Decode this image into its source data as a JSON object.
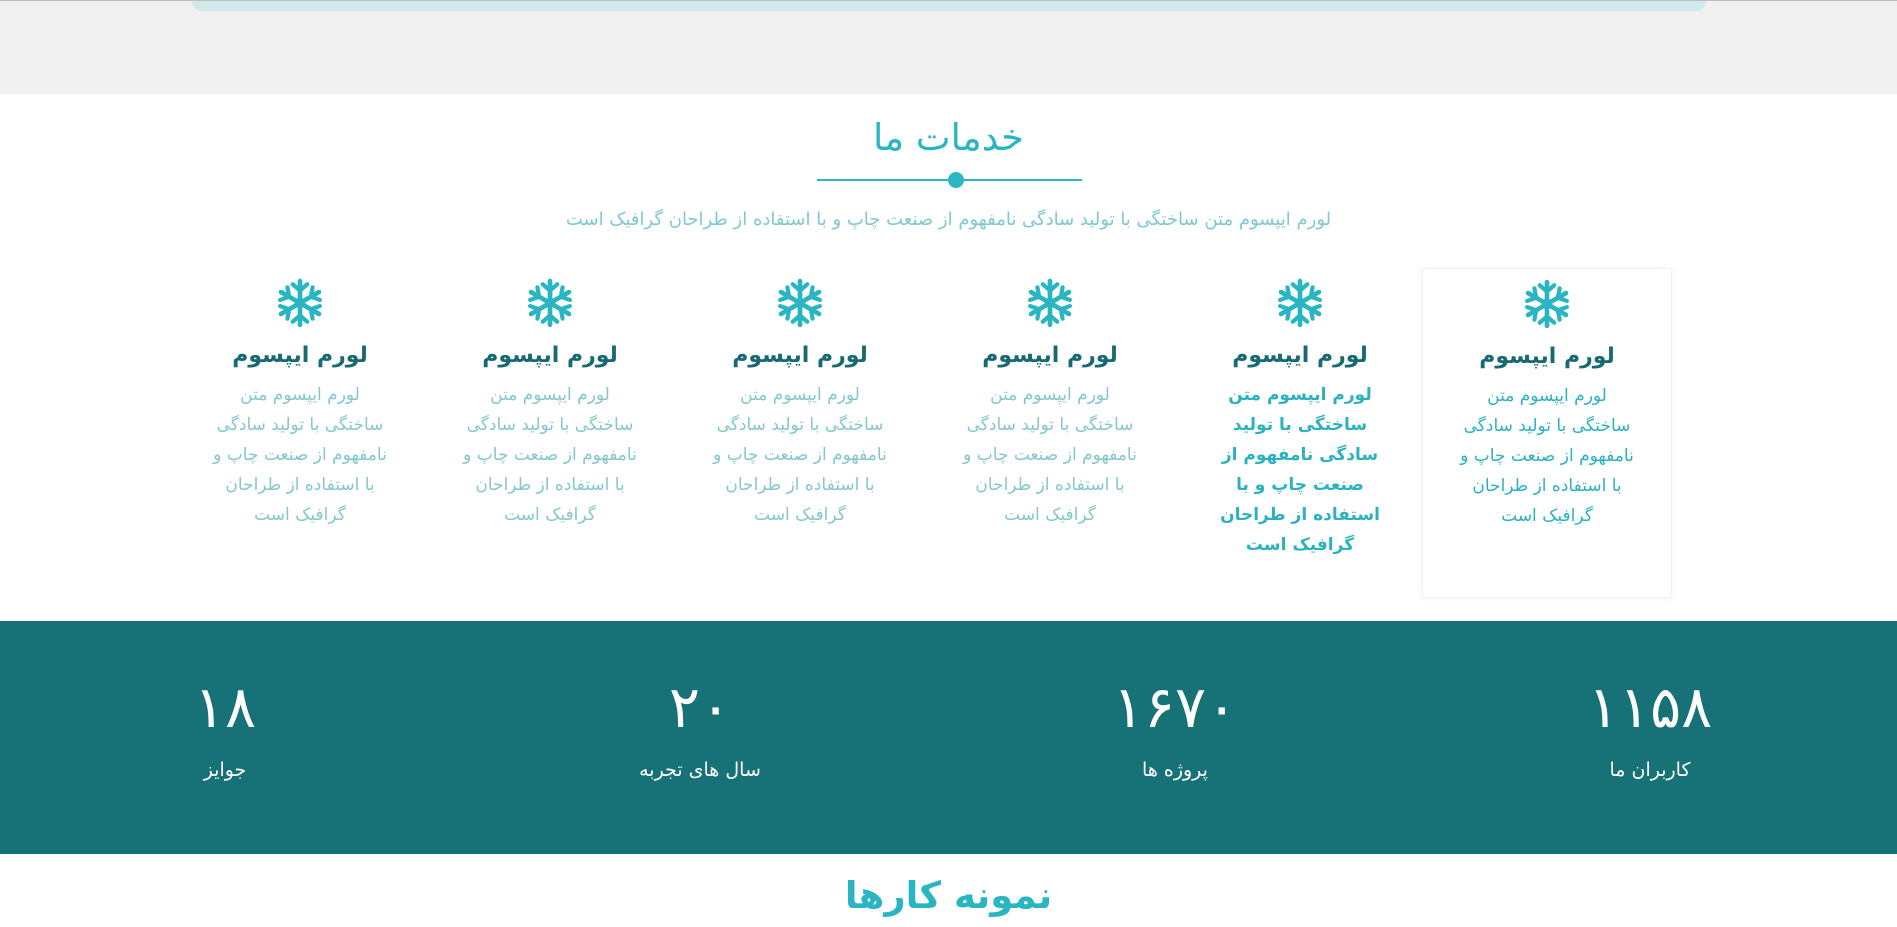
{
  "services": {
    "title": "خدمات ما",
    "subtitle": "لورم ایپسوم متن ساختگی با تولید سادگی نامفهوم از صنعت چاپ و با استفاده از طراحان گرافیک است",
    "icon": "snowflake-icon",
    "accent_color": "#29b6c2",
    "cards": [
      {
        "title": "لورم ایپسوم",
        "text": "لورم ایپسوم متن ساختگی با تولید سادگی نامفهوم از صنعت چاپ و با استفاده از طراحان گرافیک است"
      },
      {
        "title": "لورم ایپسوم",
        "text": "لورم ایپسوم متن ساختگی با تولید سادگی نامفهوم از صنعت چاپ و با استفاده از طراحان گرافیک است"
      },
      {
        "title": "لورم ایپسوم",
        "text": "لورم ایپسوم متن ساختگی با تولید سادگی نامفهوم از صنعت چاپ و با استفاده از طراحان گرافیک است"
      },
      {
        "title": "لورم ایپسوم",
        "text": "لورم ایپسوم متن ساختگی با تولید سادگی نامفهوم از صنعت چاپ و با استفاده از طراحان گرافیک است"
      },
      {
        "title": "لورم ایپسوم",
        "text": "لورم ایپسوم متن ساختگی با تولید سادگی نامفهوم از صنعت چاپ و با استفاده از طراحان گرافیک است"
      },
      {
        "title": "لورم ایپسوم",
        "text": "لورم ایپسوم متن ساختگی با تولید سادگی نامفهوم از صنعت چاپ و با استفاده از طراحان گرافیک است"
      }
    ]
  },
  "stats": {
    "background_color": "#177278",
    "items": [
      {
        "number": "۱۱۵۸",
        "label": "کاربران ما"
      },
      {
        "number": "۱۶۷۰",
        "label": "پروژه ها"
      },
      {
        "number": "۲۰",
        "label": "سال های تجربه"
      },
      {
        "number": "۱۸",
        "label": "جوایز"
      }
    ]
  },
  "portfolio": {
    "title": "نمونه کارها"
  }
}
